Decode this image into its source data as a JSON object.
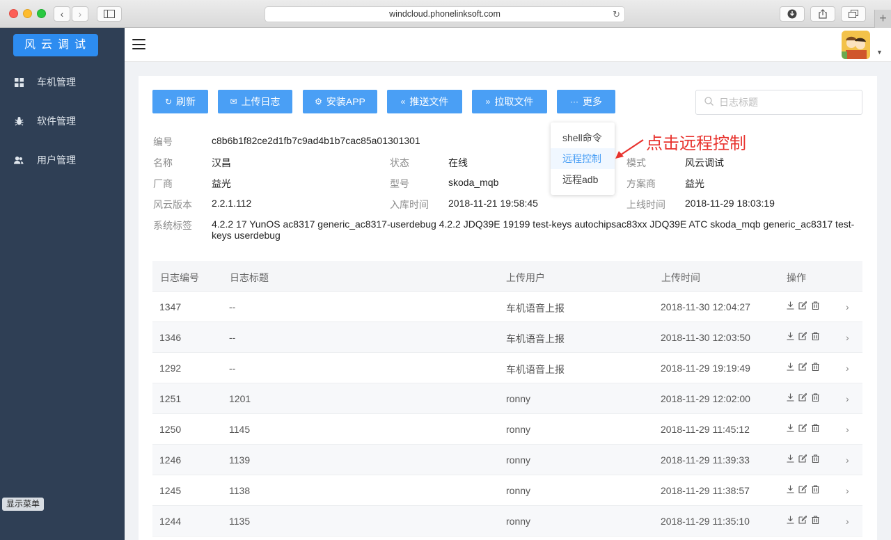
{
  "browser": {
    "url": "windcloud.phonelinksoft.com",
    "back": "‹",
    "forward": "›"
  },
  "sidebar": {
    "brand": "风云调试",
    "items": [
      {
        "label": "车机管理",
        "icon": "grid-icon"
      },
      {
        "label": "软件管理",
        "icon": "bug-icon"
      },
      {
        "label": "用户管理",
        "icon": "users-icon"
      }
    ],
    "show_menu": "显示菜单"
  },
  "toolbar": {
    "buttons": [
      {
        "label": "刷新",
        "icon": "↻"
      },
      {
        "label": "上传日志",
        "icon": "✉"
      },
      {
        "label": "安装APP",
        "icon": "⚙"
      },
      {
        "label": "推送文件",
        "icon": "«"
      },
      {
        "label": "拉取文件",
        "icon": "»"
      },
      {
        "label": "更多",
        "icon": "···"
      }
    ],
    "search_placeholder": "日志标题"
  },
  "dropdown": {
    "items": [
      "shell命令",
      "远程控制",
      "远程adb"
    ],
    "active_index": 1
  },
  "annotation": "点击远程控制",
  "info": {
    "id_label": "编号",
    "id_value": "c8b6b1f82ce2d1fb7c9ad4b1b7cac85a01301301",
    "name_label": "名称",
    "name_value": "汉昌",
    "status_label": "状态",
    "status_value": "在线",
    "mode_label": "模式",
    "mode_value": "风云调试",
    "vendor_label": "厂商",
    "vendor_value": "益光",
    "model_label": "型号",
    "model_value": "skoda_mqb",
    "solution_label": "方案商",
    "solution_value": "益光",
    "version_label": "风云版本",
    "version_value": "2.2.1.112",
    "storage_time_label": "入库时间",
    "storage_time_value": "2018-11-21 19:58:45",
    "online_time_label": "上线时间",
    "online_time_value": "2018-11-29 18:03:19",
    "tags_label": "系统标签",
    "tags_value": "4.2.2 17 YunOS ac8317 generic_ac8317-userdebug 4.2.2 JDQ39E 19199 test-keys autochipsac83xx JDQ39E ATC skoda_mqb generic_ac8317 test-keys userdebug"
  },
  "table": {
    "headers": [
      "日志编号",
      "日志标题",
      "上传用户",
      "上传时间",
      "操作"
    ],
    "rows": [
      {
        "id": "1347",
        "title": "--",
        "user": "车机语音上报",
        "time": "2018-11-30 12:04:27"
      },
      {
        "id": "1346",
        "title": "--",
        "user": "车机语音上报",
        "time": "2018-11-30 12:03:50"
      },
      {
        "id": "1292",
        "title": "--",
        "user": "车机语音上报",
        "time": "2018-11-29 19:19:49"
      },
      {
        "id": "1251",
        "title": "1201",
        "user": "ronny",
        "time": "2018-11-29 12:02:00"
      },
      {
        "id": "1250",
        "title": "1145",
        "user": "ronny",
        "time": "2018-11-29 11:45:12"
      },
      {
        "id": "1246",
        "title": "1139",
        "user": "ronny",
        "time": "2018-11-29 11:39:33"
      },
      {
        "id": "1245",
        "title": "1138",
        "user": "ronny",
        "time": "2018-11-29 11:38:57"
      },
      {
        "id": "1244",
        "title": "1135",
        "user": "ronny",
        "time": "2018-11-29 11:35:10"
      }
    ]
  },
  "colors": {
    "primary": "#4a9ff5",
    "sidebar": "#2f3f55",
    "brand": "#2d8cf0",
    "annotation": "#e8322d"
  }
}
